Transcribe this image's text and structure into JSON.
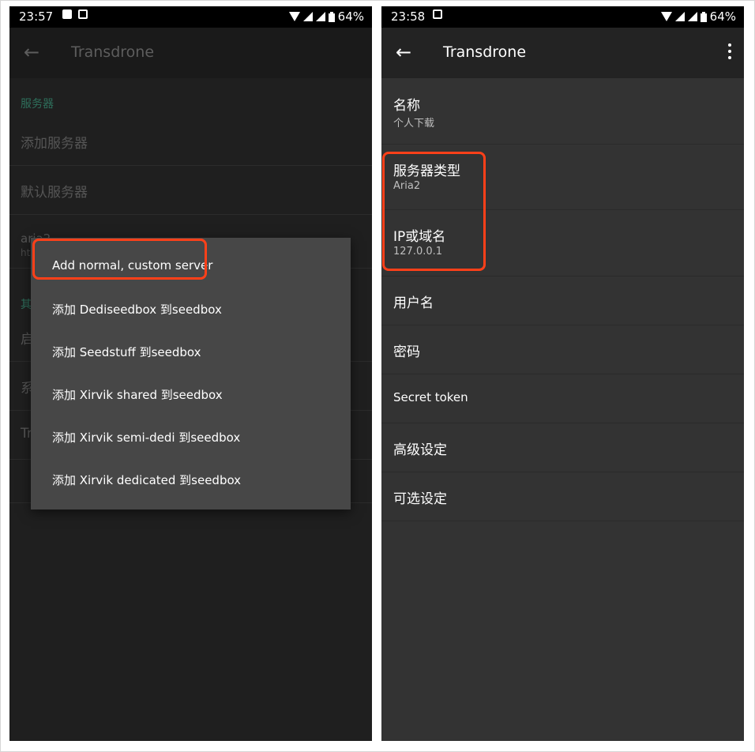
{
  "left": {
    "status": {
      "time": "23:57",
      "battery": "64%"
    },
    "toolbar": {
      "back_glyph": "←",
      "title": "Transdrone"
    },
    "section_servers": "服务器",
    "rows": [
      {
        "label": "添加服务器"
      },
      {
        "label": "默认服务器"
      }
    ],
    "partial": {
      "aria_label": "aria2",
      "aria_sub": "ht",
      "section_other": "其",
      "row1": "启",
      "row2": "系",
      "row3": "Tr"
    },
    "popup_items": [
      "Add normal, custom server",
      "添加 Dediseedbox 到seedbox",
      "添加 Seedstuff 到seedbox",
      "添加 Xirvik shared 到seedbox",
      "添加 Xirvik semi-dedi 到seedbox",
      "添加 Xirvik dedicated 到seedbox"
    ]
  },
  "right": {
    "status": {
      "time": "23:58",
      "battery": "64%"
    },
    "toolbar": {
      "back_glyph": "←",
      "title": "Transdrone"
    },
    "rows": [
      {
        "label": "名称",
        "sub": "个人下载"
      },
      {
        "label": "服务器类型",
        "sub": "Aria2"
      },
      {
        "label": "IP或域名",
        "sub": "127.0.0.1"
      },
      {
        "label": "用户名"
      },
      {
        "label": "密码"
      },
      {
        "label": "Secret token"
      },
      {
        "label": "高级设定"
      },
      {
        "label": "可选设定"
      }
    ]
  },
  "colors": {
    "highlight": "#ff4019",
    "section_accent": "#2e6f5b"
  }
}
